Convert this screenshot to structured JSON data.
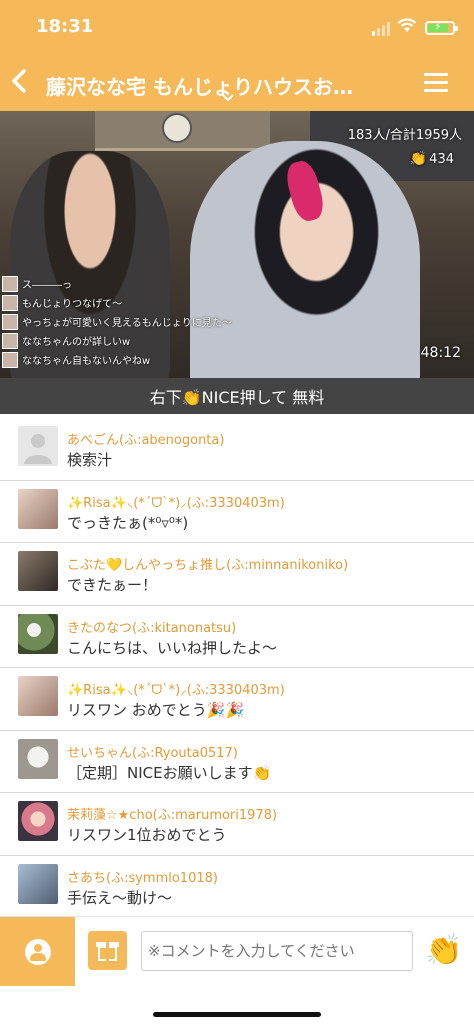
{
  "status_bar": {
    "time": "18:31"
  },
  "header": {
    "back_icon": "chevron-left-icon",
    "title": "藤沢なな宅 もんじょりハウスお…",
    "menu_icon": "hamburger-icon"
  },
  "video": {
    "viewers": "183人/合計1959人",
    "likes": "434",
    "duration": "48:12",
    "overlay_comments": [
      "ス―――っ",
      "もんじょりつなげて～",
      "やっちょが可愛いく見えるもんじょりに見た～",
      "ななちゃんのが詳しいw",
      "ななちゃん自もないんやねw"
    ]
  },
  "banner": {
    "text": "右下👏NICE押して 無料"
  },
  "comments": [
    {
      "name": "あべごん(ふ:abenogonta)",
      "text": "検索汁",
      "avatar_color": "#e6e6e6"
    },
    {
      "name": "✨Risa✨⸜(*ˊᗜˋ*)⸝(ふ:3330403m)",
      "text": "でっきたぁ(*⁰▿⁰*)",
      "avatar_color": "#c9a69a"
    },
    {
      "name": "こぶた💛しんやっちょ推し(ふ:minnanikoniko)",
      "text": "できたぁー！",
      "avatar_color": "#5d5148"
    },
    {
      "name": "きたのなつ(ふ:kitanonatsu)",
      "text": "こんにちは、いいね押したよ～",
      "avatar_color": "#8fa37a"
    },
    {
      "name": "✨Risa✨⸜(*ˊᗜˋ*)⸝(ふ:3330403m)",
      "text": "リスワン おめでとう🎉🎉",
      "avatar_color": "#c9a69a"
    },
    {
      "name": "せいちゃん(ふ:Ryouta0517)",
      "text": "［定期］NICEお願いします👏",
      "avatar_color": "#b0aca8"
    },
    {
      "name": "茉莉藻☆★cho(ふ:marumori1978)",
      "text": "リスワン1位おめでとう",
      "avatar_color": "#d88a8a"
    },
    {
      "name": "さあち(ふ:symmlo1018)",
      "text": "手伝え～動け～",
      "avatar_color": "#7e93ad"
    }
  ],
  "composer": {
    "placeholder": "※コメントを入力してください",
    "profile_icon": "user-icon",
    "gift_icon": "gift-icon",
    "nice_icon": "clap-icon"
  },
  "colors": {
    "accent": "#F5B95A",
    "name_color": "#E39A36",
    "banner_bg": "#444444"
  }
}
